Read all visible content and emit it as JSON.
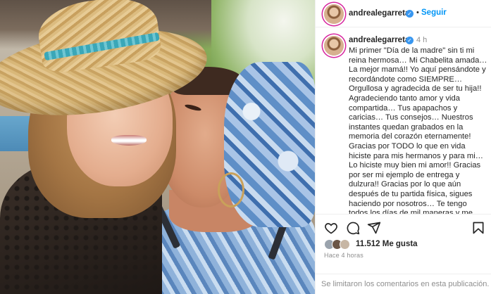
{
  "post": {
    "username": "andrealegarreta",
    "verified": true,
    "follow_label": "Seguir",
    "separator": "•",
    "time_ago": "4 h",
    "caption": "Mi primer \"Día de la madre\" sin ti mi reina hermosa… Mi Chabelita amada… La mejor mamá!! Yo aquí pensándote y recordándote como SIEMPRE… Orgullosa y agradecida de ser tu hija!! Agradeciendo tanto amor y vida compartida… Tus apapachos y caricias… Tus consejos… Nuestros instantes quedan grabados en la memoria del corazón eternamente! Gracias por TODO lo que en vida hiciste para mis hermanos y para mi… Lo hiciste muy bien mi amor!! Gracias por ser mi ejemplo de entrega y dulzura!! Gracias por lo que aún después de tu partida física, sigues haciendo por nosotros… Te tengo todos los días de mil maneras y me faltas todos los días de mil maneras…",
    "likes_label": "11.512 Me gusta",
    "posted_label": "Hace 4 horas",
    "comments_disabled": "Se limitaron los comentarios en esta publicación."
  },
  "icons": {
    "like": "heart-icon",
    "comment": "comment-icon",
    "share": "share-icon",
    "save": "bookmark-icon",
    "verified": "verified-badge-icon"
  },
  "colors": {
    "link": "#0095f6",
    "verified": "#3897f0",
    "muted": "#8e8e8e",
    "text": "#262626",
    "story_ring": "#d6249f"
  }
}
